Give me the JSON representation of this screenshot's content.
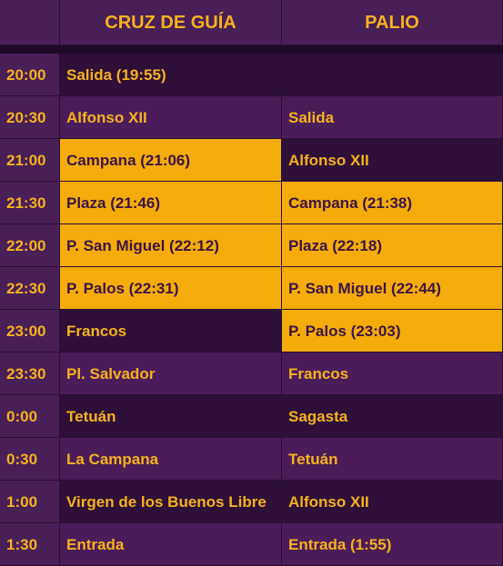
{
  "header": {
    "time_label": "",
    "cruz_label": "CRUZ DE GUÍA",
    "palio_label": "PALIO"
  },
  "colors": {
    "background_purple": "#491f57",
    "background_dark_purple": "#2e0f38",
    "highlight_gold": "#f4ac0a",
    "text_gold": "#f6b11e",
    "text_dark_purple": "#3c1448"
  },
  "rows": [
    {
      "time": "20:00",
      "cruz": "Salida (19:55)",
      "palio": "",
      "cruz_highlight": false,
      "palio_highlight": false
    },
    {
      "time": "20:30",
      "cruz": "Alfonso XII",
      "palio": "Salida",
      "cruz_highlight": false,
      "palio_highlight": false
    },
    {
      "time": "21:00",
      "cruz": "Campana (21:06)",
      "palio": "Alfonso XII",
      "cruz_highlight": true,
      "palio_highlight": false
    },
    {
      "time": "21:30",
      "cruz": "Plaza (21:46)",
      "palio": "Campana (21:38)",
      "cruz_highlight": true,
      "palio_highlight": true
    },
    {
      "time": "22:00",
      "cruz": "P. San Miguel (22:12)",
      "palio": "Plaza (22:18)",
      "cruz_highlight": true,
      "palio_highlight": true
    },
    {
      "time": "22:30",
      "cruz": "P. Palos (22:31)",
      "palio": "P. San Miguel (22:44)",
      "cruz_highlight": true,
      "palio_highlight": true
    },
    {
      "time": "23:00",
      "cruz": "Francos",
      "palio": "P. Palos (23:03)",
      "cruz_highlight": false,
      "palio_highlight": true
    },
    {
      "time": "23:30",
      "cruz": "Pl. Salvador",
      "palio": "Francos",
      "cruz_highlight": false,
      "palio_highlight": false
    },
    {
      "time": "0:00",
      "cruz": "Tetuán",
      "palio": "Sagasta",
      "cruz_highlight": false,
      "palio_highlight": false
    },
    {
      "time": "0:30",
      "cruz": "La Campana",
      "palio": "Tetuán",
      "cruz_highlight": false,
      "palio_highlight": false
    },
    {
      "time": "1:00",
      "cruz": "Virgen de los Buenos Libre",
      "palio": "Alfonso XII",
      "cruz_highlight": false,
      "palio_highlight": false
    },
    {
      "time": "1:30",
      "cruz": "Entrada",
      "palio": "Entrada (1:55)",
      "cruz_highlight": false,
      "palio_highlight": false
    }
  ]
}
